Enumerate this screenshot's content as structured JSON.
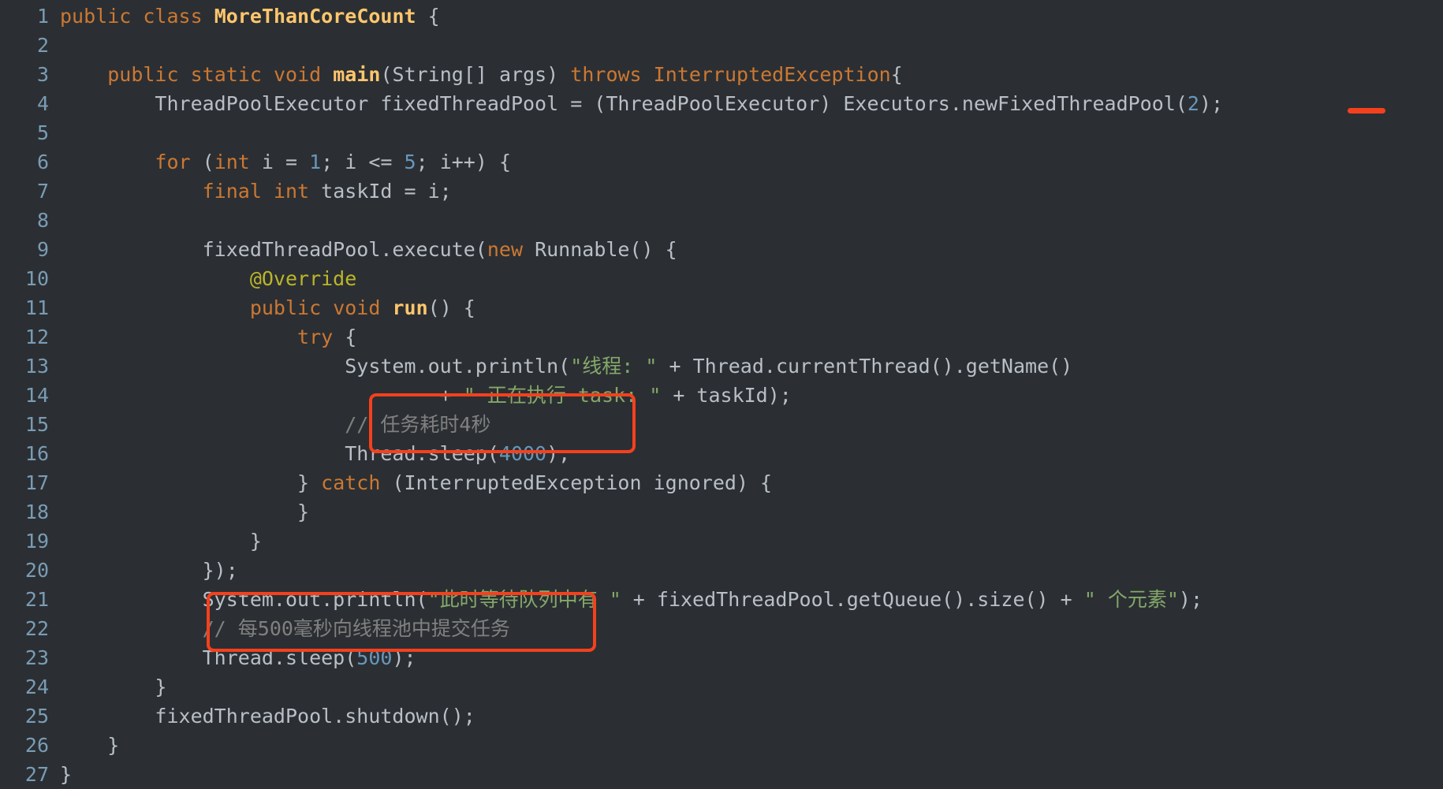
{
  "editor": {
    "language": "java",
    "background_color": "#2b2f33",
    "line_number_color": "#7a9cb5",
    "default_text_color": "#b9bfc7",
    "keyword_color": "#cc7832",
    "string_color": "#84a86a",
    "number_color": "#6897bb",
    "comment_color": "#808080",
    "annotation_color": "#bbb529",
    "class_name_color": "#ffc66d",
    "highlight_color": "#f5401d",
    "total_lines": 27
  },
  "line_numbers": [
    "1",
    "2",
    "3",
    "4",
    "5",
    "6",
    "7",
    "8",
    "9",
    "10",
    "11",
    "12",
    "13",
    "14",
    "15",
    "16",
    "17",
    "18",
    "19",
    "20",
    "21",
    "22",
    "23",
    "24",
    "25",
    "26",
    "27"
  ],
  "lines": [
    {
      "n": "1",
      "text": "public class MoreThanCoreCount {"
    },
    {
      "n": "2",
      "text": ""
    },
    {
      "n": "3",
      "text": "    public static void main(String[] args) throws InterruptedException{"
    },
    {
      "n": "4",
      "text": "        ThreadPoolExecutor fixedThreadPool = (ThreadPoolExecutor) Executors.newFixedThreadPool(2);"
    },
    {
      "n": "5",
      "text": ""
    },
    {
      "n": "6",
      "text": "        for (int i = 1; i <= 5; i++) {"
    },
    {
      "n": "7",
      "text": "            final int taskId = i;"
    },
    {
      "n": "8",
      "text": ""
    },
    {
      "n": "9",
      "text": "            fixedThreadPool.execute(new Runnable() {"
    },
    {
      "n": "10",
      "text": "                @Override"
    },
    {
      "n": "11",
      "text": "                public void run() {"
    },
    {
      "n": "12",
      "text": "                    try {"
    },
    {
      "n": "13",
      "text": "                        System.out.println(\"线程: \" + Thread.currentThread().getName()"
    },
    {
      "n": "14",
      "text": "                                + \" 正在执行 task: \" + taskId);"
    },
    {
      "n": "15",
      "text": "                        // 任务耗时4秒"
    },
    {
      "n": "16",
      "text": "                        Thread.sleep(4000);"
    },
    {
      "n": "17",
      "text": "                    } catch (InterruptedException ignored) {"
    },
    {
      "n": "18",
      "text": "                    }"
    },
    {
      "n": "19",
      "text": "                }"
    },
    {
      "n": "20",
      "text": "            });"
    },
    {
      "n": "21",
      "text": "            System.out.println(\"此时等待队列中有 \" + fixedThreadPool.getQueue().size() + \" 个元素\");"
    },
    {
      "n": "22",
      "text": "            // 每500毫秒向线程池中提交任务"
    },
    {
      "n": "23",
      "text": "            Thread.sleep(500);"
    },
    {
      "n": "24",
      "text": "        }"
    },
    {
      "n": "25",
      "text": "        fixedThreadPool.shutdown();"
    },
    {
      "n": "26",
      "text": "    }"
    },
    {
      "n": "27",
      "text": "}"
    }
  ],
  "annotations": [
    {
      "name": "pool-size-underline",
      "kind": "underline",
      "target": "(2)",
      "line": "4"
    },
    {
      "name": "task-duration-box",
      "kind": "rectangle",
      "target": "// 任务耗时4秒 / Thread.sleep(4000);",
      "lines": "15-16"
    },
    {
      "name": "submit-interval-box",
      "kind": "rectangle",
      "target": "// 每500毫秒向线程池中提交任务 / Thread.sleep(500);",
      "lines": "22-23"
    }
  ]
}
